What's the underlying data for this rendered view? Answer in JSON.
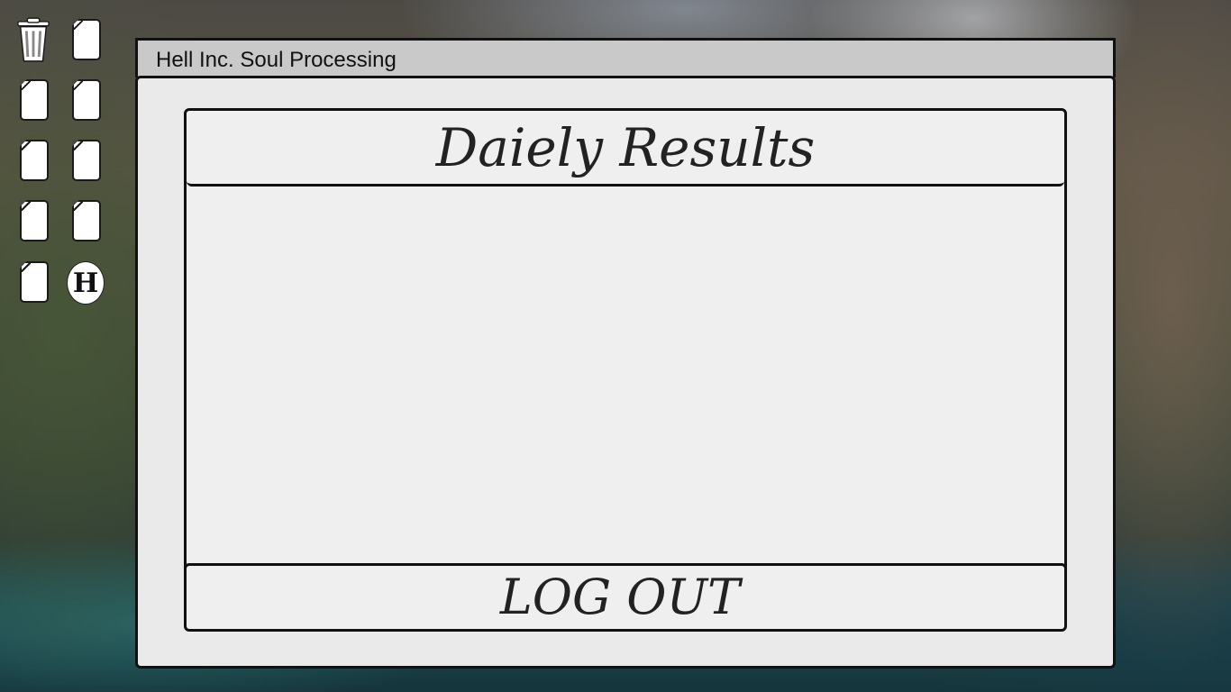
{
  "desktop": {
    "icons": [
      {
        "name": "trash-icon",
        "kind": "trash"
      },
      {
        "name": "file-icon",
        "kind": "file"
      },
      {
        "name": "file-icon",
        "kind": "file"
      },
      {
        "name": "file-icon",
        "kind": "file"
      },
      {
        "name": "file-icon",
        "kind": "file"
      },
      {
        "name": "file-icon",
        "kind": "file"
      },
      {
        "name": "file-icon",
        "kind": "file"
      },
      {
        "name": "file-icon",
        "kind": "file"
      },
      {
        "name": "file-icon",
        "kind": "file"
      },
      {
        "name": "hell-inc-app-icon",
        "kind": "app",
        "glyph": "H"
      }
    ]
  },
  "window": {
    "title": "Hell Inc. Soul Processing"
  },
  "results": {
    "title": "Daiely Results"
  },
  "actions": {
    "logout_label": "LOG OUT"
  },
  "colors": {
    "panel_bg": "#efefef",
    "titlebar_bg": "#c9c9c9",
    "border": "#111111"
  }
}
